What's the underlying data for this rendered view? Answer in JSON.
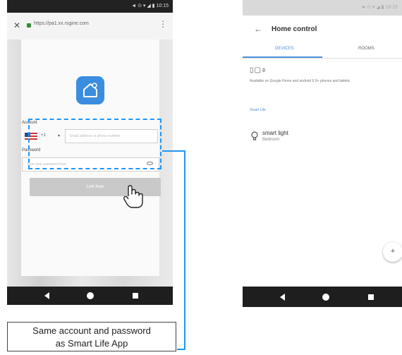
{
  "left_phone": {
    "status_time": "◄ ⊙ ▾ ◢ ▮ 10:15",
    "url": "https://pa1.xx.rsgine.com",
    "close_label": "✕",
    "menu_label": "⋮",
    "account_label": "Account",
    "country_code": "+1",
    "email_placeholder": "Email address or phone number",
    "password_label": "Password",
    "password_placeholder": "Type your password here",
    "link_button": "Link Now"
  },
  "callout": {
    "line1": "Same account and password",
    "line2": "as Smart Life App"
  },
  "right_phone": {
    "status_time": "◄ ⊙ ▾ ◢ ▮ 10:15",
    "title": "Home control",
    "tabs": [
      "DEVICES",
      "ROOMS"
    ],
    "availability": "Available on Google Home and android 6.0+ phones and tablets",
    "section": "Smart Life",
    "device": {
      "name": "smart light",
      "room": "Bedroom"
    },
    "fab": "+"
  },
  "colors": {
    "accent": "#2196f3",
    "logo": "#3b8de0"
  }
}
